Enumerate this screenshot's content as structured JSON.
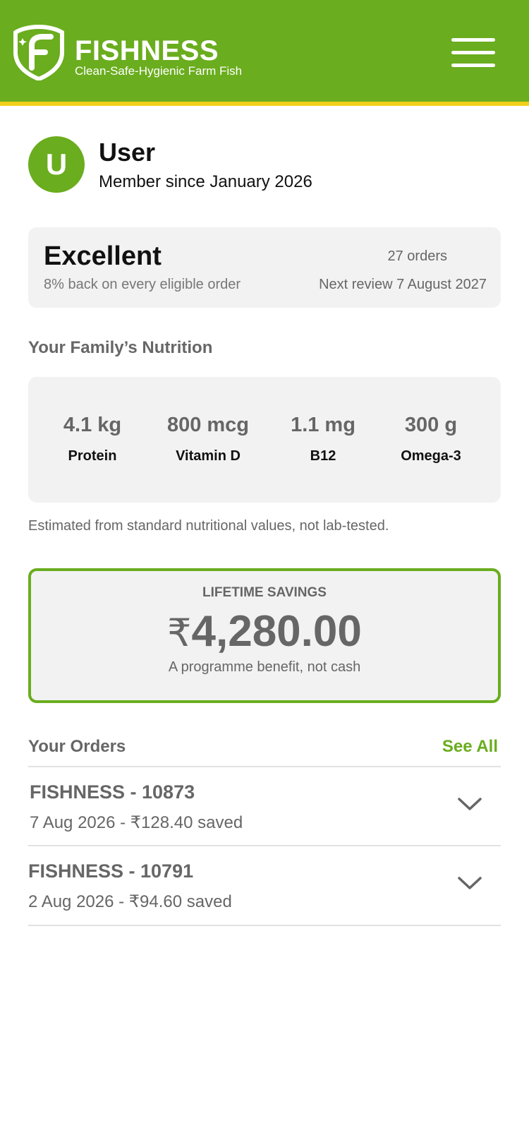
{
  "header": {
    "brand_name": "FISHNESS",
    "tagline": "Clean-Safe-Hygienic Farm Fish",
    "logo_icon": "fishness-shield-logo",
    "menu_icon": "hamburger-menu-icon",
    "bg_color": "#6aad1e",
    "accent_color": "#f2cf1a"
  },
  "profile": {
    "avatar_initial": "U",
    "name": "User",
    "member_since": "Member since January 2026"
  },
  "tier": {
    "name": "Excellent",
    "description": "8% back on every eligible order",
    "orders": "27 orders",
    "next_review": "Next review 7 August 2027"
  },
  "nutrition": {
    "title": "Your Family’s Nutrition",
    "items": [
      {
        "value": "4.1 kg",
        "label": "Protein"
      },
      {
        "value": "800 mcg",
        "label": "Vitamin D"
      },
      {
        "value": "1.1 mg",
        "label": "B12"
      },
      {
        "value": "300 g",
        "label": "Omega-3"
      }
    ],
    "note": "Estimated from standard nutritional values, not lab-tested."
  },
  "savings": {
    "title": "LIFETIME SAVINGS",
    "currency": "₹",
    "amount": "4,280.00",
    "note": "A programme benefit, not cash"
  },
  "orders": {
    "title": "Your Orders",
    "see_all": "See All",
    "list": [
      {
        "id": "FISHNESS - 10873",
        "meta": "7 Aug 2026 - ₹128.40 saved"
      },
      {
        "id": "FISHNESS - 10791",
        "meta": "2 Aug 2026 - ₹94.60 saved"
      }
    ],
    "chevron_icon": "chevron-down-icon"
  }
}
